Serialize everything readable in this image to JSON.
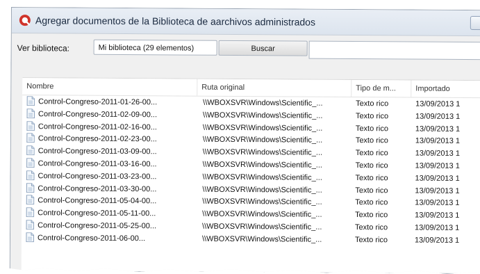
{
  "window": {
    "title": "Agregar documentos de la Biblioteca de aarchivos administrados",
    "app_icon": "app-logo-icon"
  },
  "toolbar": {
    "library_label": "Ver biblioteca:",
    "library_value": "Mi biblioteca (29 elementos)",
    "search_button": "Buscar",
    "search_value": ""
  },
  "table": {
    "columns": [
      "Nombre",
      "Ruta original",
      "Tipo de m...",
      "Importado"
    ],
    "rows": [
      {
        "name": "Control-Congreso-2011-01-26-00...",
        "path": "\\\\WBOXSVR\\Windows\\Scientific_...",
        "type": "Texto rico",
        "imported": "13/09/2013 1"
      },
      {
        "name": "Control-Congreso-2011-02-09-00...",
        "path": "\\\\WBOXSVR\\Windows\\Scientific_...",
        "type": "Texto rico",
        "imported": "13/09/2013 1"
      },
      {
        "name": "Control-Congreso-2011-02-16-00...",
        "path": "\\\\WBOXSVR\\Windows\\Scientific_...",
        "type": "Texto rico",
        "imported": "13/09/2013 1"
      },
      {
        "name": "Control-Congreso-2011-02-23-00...",
        "path": "\\\\WBOXSVR\\Windows\\Scientific_...",
        "type": "Texto rico",
        "imported": "13/09/2013 1"
      },
      {
        "name": "Control-Congreso-2011-03-09-00...",
        "path": "\\\\WBOXSVR\\Windows\\Scientific_...",
        "type": "Texto rico",
        "imported": "13/09/2013 1"
      },
      {
        "name": "Control-Congreso-2011-03-16-00...",
        "path": "\\\\WBOXSVR\\Windows\\Scientific_...",
        "type": "Texto rico",
        "imported": "13/09/2013 1"
      },
      {
        "name": "Control-Congreso-2011-03-23-00...",
        "path": "\\\\WBOXSVR\\Windows\\Scientific_...",
        "type": "Texto rico",
        "imported": "13/09/2013 1"
      },
      {
        "name": "Control-Congreso-2011-03-30-00...",
        "path": "\\\\WBOXSVR\\Windows\\Scientific_...",
        "type": "Texto rico",
        "imported": "13/09/2013 1"
      },
      {
        "name": "Control-Congreso-2011-05-04-00...",
        "path": "\\\\WBOXSVR\\Windows\\Scientific_...",
        "type": "Texto rico",
        "imported": "13/09/2013 1"
      },
      {
        "name": "Control-Congreso-2011-05-11-00...",
        "path": "\\\\WBOXSVR\\Windows\\Scientific_...",
        "type": "Texto rico",
        "imported": "13/09/2013 1"
      },
      {
        "name": "Control-Congreso-2011-05-25-00...",
        "path": "\\\\WBOXSVR\\Windows\\Scientific_...",
        "type": "Texto rico",
        "imported": "13/09/2013 1"
      },
      {
        "name": "Control-Congreso-2011-06-00...",
        "path": "\\\\WBOXSVR\\Windows\\Scientific_...",
        "type": "Texto rico",
        "imported": "13/09/2013 1"
      }
    ]
  },
  "colors": {
    "accent_red": "#d0342c",
    "titlebar": "#dce4ee"
  }
}
